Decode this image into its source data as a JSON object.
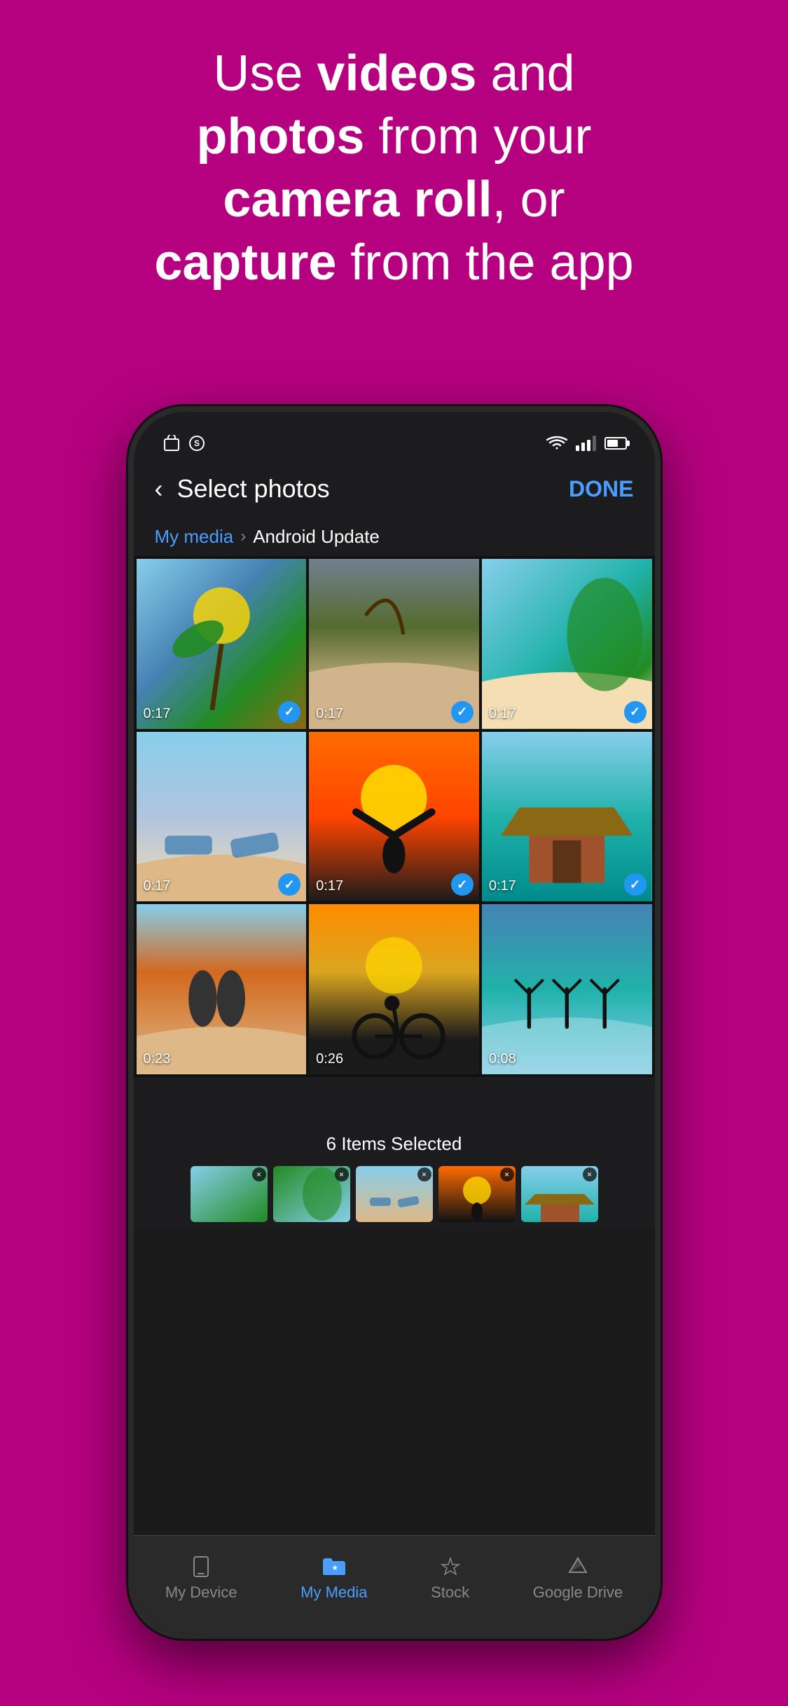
{
  "header": {
    "line1_normal": "Use ",
    "line1_bold": "videos",
    "line1_end": " and",
    "line2_bold": "photos",
    "line2_end": " from your",
    "line3_bold": "camera roll",
    "line3_end": ", or",
    "line4_bold": "capture",
    "line4_end": " from the app"
  },
  "phone": {
    "status_bar": {
      "left_icons": [
        "bag-icon",
        "s-icon"
      ],
      "right": "wifi signal battery"
    },
    "nav": {
      "back_label": "‹",
      "title": "Select photos",
      "done_label": "DONE"
    },
    "breadcrumb": {
      "link": "My media",
      "separator": "›",
      "current": "Android Update"
    },
    "grid": {
      "items": [
        {
          "duration": "0:17",
          "selected": true,
          "color_class": "photo-1"
        },
        {
          "duration": "0:17",
          "selected": true,
          "color_class": "photo-2"
        },
        {
          "duration": "0:17",
          "selected": true,
          "color_class": "photo-3"
        },
        {
          "duration": "0:17",
          "selected": true,
          "color_class": "photo-4"
        },
        {
          "duration": "0:17",
          "selected": true,
          "color_class": "photo-5"
        },
        {
          "duration": "0:17",
          "selected": true,
          "color_class": "photo-6"
        },
        {
          "duration": "0:23",
          "selected": false,
          "color_class": "photo-7"
        },
        {
          "duration": "0:26",
          "selected": false,
          "color_class": "photo-8"
        },
        {
          "duration": "0:08",
          "selected": false,
          "color_class": "photo-9"
        }
      ]
    },
    "selected_bar": {
      "count_label": "6 Items Selected",
      "thumbnails": [
        {
          "color_class": "photo-1"
        },
        {
          "color_class": "photo-3"
        },
        {
          "color_class": "photo-4"
        },
        {
          "color_class": "photo-5"
        },
        {
          "color_class": "photo-6"
        },
        {
          "color_class": "photo-2"
        }
      ]
    },
    "tab_bar": {
      "tabs": [
        {
          "id": "my-device",
          "label": "My Device",
          "active": false
        },
        {
          "id": "my-media",
          "label": "My Media",
          "active": true
        },
        {
          "id": "stock",
          "label": "Stock",
          "active": false
        },
        {
          "id": "google-drive",
          "label": "Google Drive",
          "active": false
        }
      ]
    }
  },
  "colors": {
    "brand": "#b5007f",
    "active_tab": "#4a9eff",
    "inactive_tab": "#888888",
    "screen_bg": "#1c1c1e",
    "selection": "#2196F3"
  }
}
